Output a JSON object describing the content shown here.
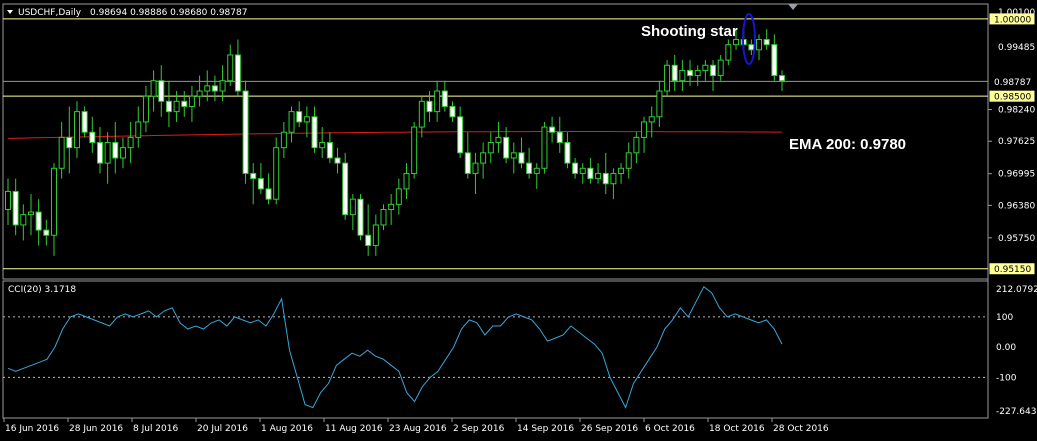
{
  "chart_data": {
    "type": "candlestick",
    "symbol_header": "USDCHF,Daily",
    "ohlc_header": "0.98694 0.98886 0.98680 0.98787",
    "ylim": [
      0.9497,
      1.0027
    ],
    "y_ticks": [
      "0.98240",
      "0.97625",
      "0.96995",
      "0.96380",
      "0.95750"
    ],
    "axis_top_label": "1.00100",
    "axis_second_label": "0.99485",
    "x_labels": [
      "16 Jun 2016",
      "28 Jun 2016",
      "8 Jul 2016",
      "20 Jul 2016",
      "1 Aug 2016",
      "11 Aug 2016",
      "23 Aug 2016",
      "2 Sep 2016",
      "14 Sep 2016",
      "26 Sep 2016",
      "6 Oct 2016",
      "18 Oct 2016",
      "28 Oct 2016"
    ],
    "hlines": [
      {
        "value": 1.0,
        "label": "1.00000",
        "color": "#ffff99"
      },
      {
        "value": 0.985,
        "label": "0.98500",
        "color": "#ffff99"
      },
      {
        "value": 0.9515,
        "label": "0.95150",
        "color": "#ffff99"
      },
      {
        "value": 0.98787,
        "label": "0.98787",
        "color": "#8a9aa6"
      }
    ],
    "ema": {
      "label": "EMA 200: 0.9780",
      "value": 0.978,
      "color": "#e01b1b"
    },
    "annotation": {
      "text": "Shooting star"
    },
    "colors": {
      "bull": "#ffffff",
      "bear": "#ffffff",
      "wick": "#33cc33",
      "cci": "#3aa6d8"
    },
    "candles": [
      [
        0.963,
        0.969,
        0.96,
        0.9665
      ],
      [
        0.9665,
        0.969,
        0.958,
        0.96
      ],
      [
        0.96,
        0.964,
        0.957,
        0.962
      ],
      [
        0.962,
        0.966,
        0.958,
        0.9625
      ],
      [
        0.9625,
        0.965,
        0.956,
        0.959
      ],
      [
        0.959,
        0.961,
        0.956,
        0.958
      ],
      [
        0.958,
        0.972,
        0.954,
        0.971
      ],
      [
        0.971,
        0.98,
        0.969,
        0.977
      ],
      [
        0.977,
        0.983,
        0.97,
        0.975
      ],
      [
        0.975,
        0.984,
        0.973,
        0.982
      ],
      [
        0.982,
        0.983,
        0.977,
        0.978
      ],
      [
        0.978,
        0.981,
        0.974,
        0.976
      ],
      [
        0.976,
        0.979,
        0.97,
        0.972
      ],
      [
        0.972,
        0.978,
        0.968,
        0.976
      ],
      [
        0.976,
        0.98,
        0.97,
        0.973
      ],
      [
        0.973,
        0.977,
        0.971,
        0.975
      ],
      [
        0.975,
        0.98,
        0.972,
        0.977
      ],
      [
        0.977,
        0.983,
        0.975,
        0.98
      ],
      [
        0.98,
        0.987,
        0.978,
        0.985
      ],
      [
        0.985,
        0.99,
        0.982,
        0.988
      ],
      [
        0.988,
        0.991,
        0.981,
        0.984
      ],
      [
        0.984,
        0.988,
        0.979,
        0.982
      ],
      [
        0.982,
        0.986,
        0.98,
        0.984
      ],
      [
        0.984,
        0.986,
        0.981,
        0.983
      ],
      [
        0.983,
        0.987,
        0.98,
        0.985
      ],
      [
        0.985,
        0.989,
        0.983,
        0.986
      ],
      [
        0.986,
        0.99,
        0.984,
        0.987
      ],
      [
        0.987,
        0.989,
        0.984,
        0.986
      ],
      [
        0.986,
        0.991,
        0.984,
        0.988
      ],
      [
        0.988,
        0.995,
        0.987,
        0.993
      ],
      [
        0.993,
        0.996,
        0.985,
        0.986
      ],
      [
        0.986,
        0.988,
        0.968,
        0.97
      ],
      [
        0.97,
        0.972,
        0.964,
        0.969
      ],
      [
        0.969,
        0.972,
        0.966,
        0.967
      ],
      [
        0.967,
        0.97,
        0.964,
        0.965
      ],
      [
        0.965,
        0.977,
        0.964,
        0.975
      ],
      [
        0.975,
        0.98,
        0.973,
        0.978
      ],
      [
        0.978,
        0.983,
        0.976,
        0.982
      ],
      [
        0.982,
        0.984,
        0.979,
        0.98
      ],
      [
        0.98,
        0.983,
        0.977,
        0.981
      ],
      [
        0.981,
        0.983,
        0.974,
        0.975
      ],
      [
        0.975,
        0.979,
        0.973,
        0.976
      ],
      [
        0.976,
        0.978,
        0.972,
        0.973
      ],
      [
        0.973,
        0.975,
        0.97,
        0.972
      ],
      [
        0.972,
        0.974,
        0.961,
        0.962
      ],
      [
        0.962,
        0.966,
        0.959,
        0.965
      ],
      [
        0.965,
        0.966,
        0.957,
        0.958
      ],
      [
        0.958,
        0.964,
        0.954,
        0.956
      ],
      [
        0.956,
        0.962,
        0.954,
        0.96
      ],
      [
        0.96,
        0.964,
        0.959,
        0.963
      ],
      [
        0.963,
        0.966,
        0.96,
        0.964
      ],
      [
        0.964,
        0.969,
        0.962,
        0.967
      ],
      [
        0.967,
        0.972,
        0.965,
        0.97
      ],
      [
        0.97,
        0.98,
        0.969,
        0.979
      ],
      [
        0.979,
        0.985,
        0.977,
        0.984
      ],
      [
        0.984,
        0.986,
        0.98,
        0.982
      ],
      [
        0.982,
        0.988,
        0.98,
        0.986
      ],
      [
        0.986,
        0.988,
        0.982,
        0.983
      ],
      [
        0.983,
        0.984,
        0.98,
        0.981
      ],
      [
        0.981,
        0.983,
        0.973,
        0.974
      ],
      [
        0.974,
        0.978,
        0.969,
        0.97
      ],
      [
        0.97,
        0.974,
        0.966,
        0.972
      ],
      [
        0.972,
        0.976,
        0.969,
        0.974
      ],
      [
        0.974,
        0.978,
        0.972,
        0.976
      ],
      [
        0.976,
        0.98,
        0.974,
        0.977
      ],
      [
        0.977,
        0.979,
        0.972,
        0.973
      ],
      [
        0.973,
        0.976,
        0.97,
        0.974
      ],
      [
        0.974,
        0.977,
        0.971,
        0.972
      ],
      [
        0.972,
        0.975,
        0.969,
        0.97
      ],
      [
        0.97,
        0.972,
        0.967,
        0.971
      ],
      [
        0.971,
        0.98,
        0.97,
        0.979
      ],
      [
        0.979,
        0.981,
        0.976,
        0.978
      ],
      [
        0.978,
        0.981,
        0.974,
        0.976
      ],
      [
        0.976,
        0.978,
        0.971,
        0.972
      ],
      [
        0.972,
        0.973,
        0.969,
        0.97
      ],
      [
        0.97,
        0.972,
        0.968,
        0.971
      ],
      [
        0.971,
        0.973,
        0.968,
        0.969
      ],
      [
        0.969,
        0.972,
        0.968,
        0.97
      ],
      [
        0.97,
        0.974,
        0.966,
        0.968
      ],
      [
        0.968,
        0.971,
        0.965,
        0.97
      ],
      [
        0.97,
        0.972,
        0.968,
        0.971
      ],
      [
        0.971,
        0.976,
        0.969,
        0.974
      ],
      [
        0.974,
        0.978,
        0.972,
        0.977
      ],
      [
        0.977,
        0.981,
        0.974,
        0.98
      ],
      [
        0.98,
        0.983,
        0.977,
        0.981
      ],
      [
        0.981,
        0.988,
        0.979,
        0.986
      ],
      [
        0.986,
        0.992,
        0.985,
        0.991
      ],
      [
        0.991,
        0.993,
        0.986,
        0.988
      ],
      [
        0.988,
        0.992,
        0.986,
        0.99
      ],
      [
        0.99,
        0.992,
        0.987,
        0.989
      ],
      [
        0.989,
        0.991,
        0.987,
        0.99
      ],
      [
        0.99,
        0.992,
        0.988,
        0.991
      ],
      [
        0.991,
        0.992,
        0.986,
        0.989
      ],
      [
        0.989,
        0.993,
        0.988,
        0.992
      ],
      [
        0.992,
        0.996,
        0.991,
        0.995
      ],
      [
        0.995,
        0.998,
        0.994,
        0.996
      ],
      [
        0.996,
        0.999,
        0.994,
        0.995
      ],
      [
        0.995,
        0.996,
        0.993,
        0.994
      ],
      [
        0.994,
        0.997,
        0.992,
        0.996
      ],
      [
        0.996,
        0.998,
        0.994,
        0.995
      ],
      [
        0.995,
        0.997,
        0.988,
        0.989
      ],
      [
        0.989,
        0.99,
        0.986,
        0.988
      ]
    ],
    "cci": {
      "label": "CCI(20) 3.1718",
      "ylim": [
        -227.6436,
        212.0792
      ],
      "levels": [
        100,
        -100
      ],
      "axis_labels": [
        "212.0792",
        "100",
        "0.00",
        "-100",
        "-227.6436"
      ],
      "values": [
        -70,
        -80,
        -70,
        -60,
        -50,
        -40,
        0,
        60,
        100,
        110,
        100,
        90,
        80,
        70,
        100,
        110,
        100,
        110,
        120,
        100,
        120,
        130,
        80,
        60,
        70,
        60,
        80,
        90,
        70,
        100,
        90,
        80,
        90,
        70,
        110,
        160,
        -10,
        -100,
        -190,
        -200,
        -150,
        -120,
        -60,
        -40,
        -20,
        -30,
        -10,
        -30,
        -40,
        -60,
        -80,
        -150,
        -180,
        -130,
        -100,
        -80,
        -40,
        0,
        60,
        90,
        80,
        40,
        70,
        70,
        100,
        110,
        100,
        90,
        60,
        20,
        30,
        40,
        70,
        50,
        30,
        10,
        -20,
        -100,
        -150,
        -200,
        -120,
        -80,
        -40,
        0,
        60,
        90,
        130,
        100,
        150,
        200,
        180,
        130,
        100,
        110,
        100,
        90,
        80,
        90,
        60,
        10
      ]
    }
  }
}
